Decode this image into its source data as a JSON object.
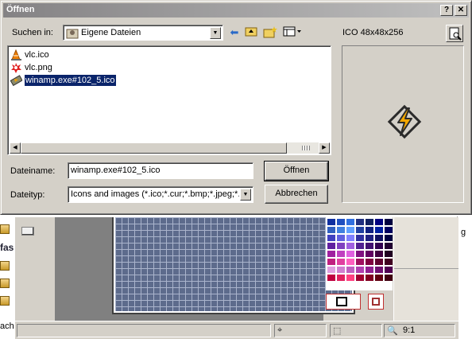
{
  "dialog": {
    "title": "Öffnen",
    "help_button": "?",
    "close_button": "✕",
    "look_in_label": "Suchen in:",
    "look_in_value": "Eigene Dateien",
    "file_name_label": "Dateiname:",
    "file_name_value": "winamp.exe#102_5.ico",
    "file_type_label": "Dateityp:",
    "file_type_value": "Icons and images (*.ico;*.cur;*.bmp;*.jpeg;*.pn",
    "open_button": "Öffnen",
    "cancel_button": "Abbrechen",
    "preview_info": "ICO 48x48x256"
  },
  "files": [
    {
      "name": "vlc.ico",
      "icon": "vlc-cone-icon",
      "selected": false
    },
    {
      "name": "vlc.png",
      "icon": "vlc-png-icon",
      "selected": false
    },
    {
      "name": "winamp.exe#102_5.ico",
      "icon": "winamp-icon",
      "selected": true
    }
  ],
  "background_app": {
    "left_fragment_top": "fas",
    "left_fragment_bottom": "ach",
    "right_fragment": "g",
    "zoom_label": "9:1"
  },
  "colors": {
    "titlebar_start": "#848284",
    "selection": "#0a246a",
    "canvas": "#5d6b8c"
  }
}
